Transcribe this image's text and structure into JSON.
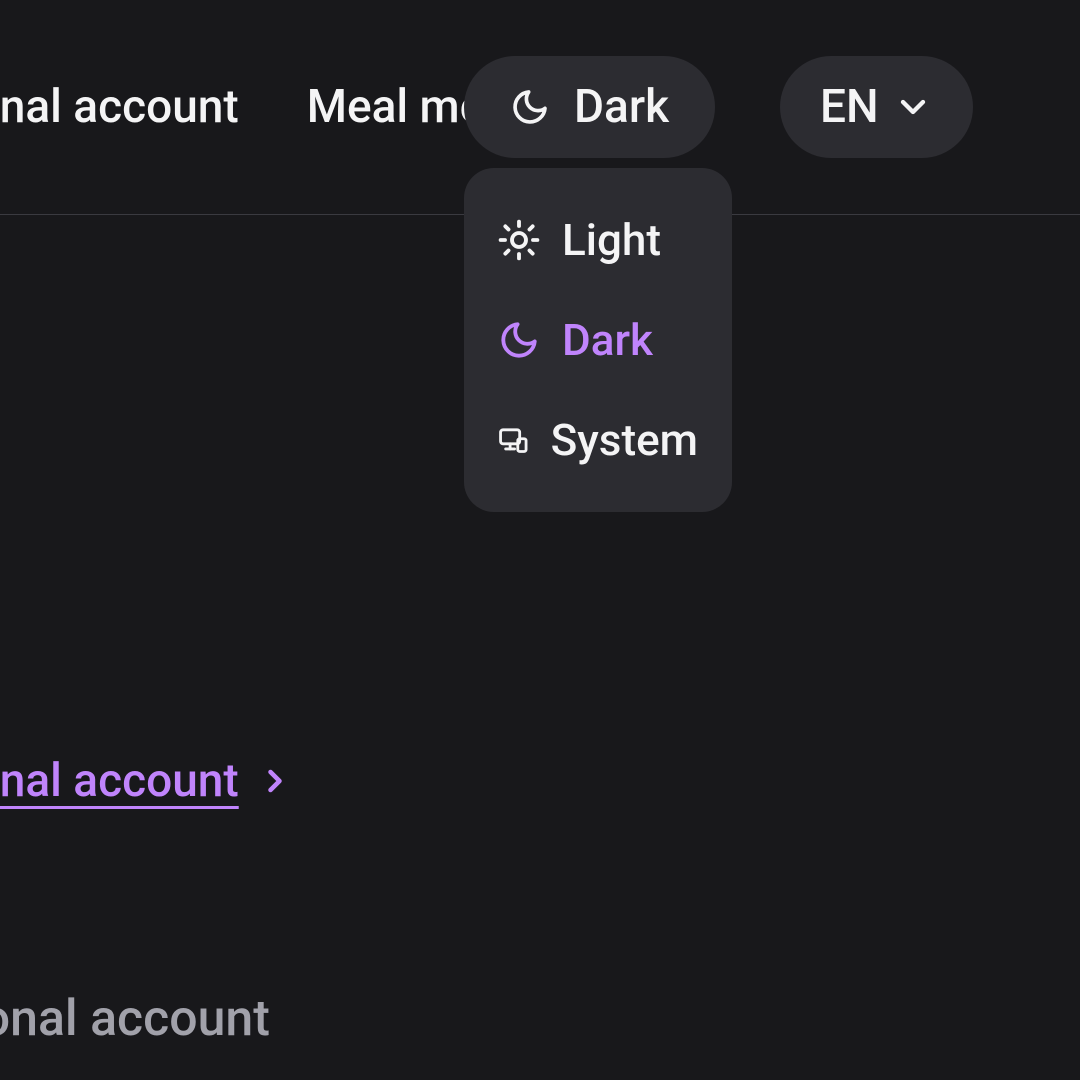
{
  "nav": {
    "item_account": "Personal account",
    "item_meals": "Meal menus"
  },
  "theme": {
    "current": "Dark",
    "options": {
      "light": "Light",
      "dark": "Dark",
      "system": "System"
    }
  },
  "language": {
    "current": "EN"
  },
  "breadcrumb": {
    "link_label": "Personal account"
  },
  "page": {
    "heading_partial": "Personal account"
  },
  "colors": {
    "accent": "#c084fc",
    "bg": "#18181b",
    "surface": "#2c2c31",
    "text": "#f4f4f5",
    "muted": "#a1a1aa"
  }
}
